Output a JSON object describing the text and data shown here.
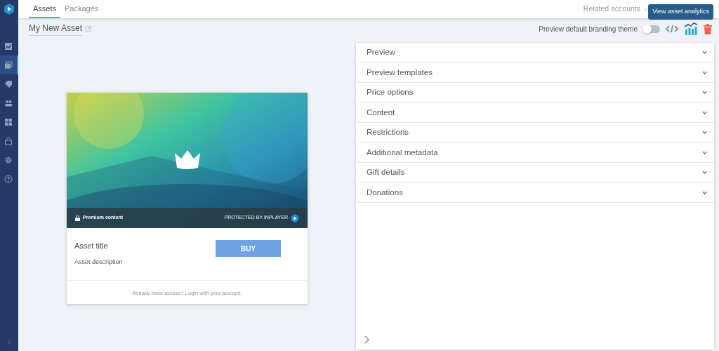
{
  "sidebar": {
    "items": [
      {
        "kind": "chart",
        "selected": false
      },
      {
        "kind": "media",
        "selected": true
      },
      {
        "kind": "tag",
        "selected": false
      },
      {
        "kind": "people",
        "selected": false
      },
      {
        "kind": "grid",
        "selected": false
      },
      {
        "kind": "lock",
        "selected": false
      },
      {
        "kind": "gear",
        "selected": false
      },
      {
        "kind": "help",
        "selected": false
      }
    ]
  },
  "tabs": [
    {
      "label": "Assets",
      "selected": true
    },
    {
      "label": "Packages",
      "selected": false
    }
  ],
  "related_accounts": "Related accounts",
  "asset_name": "My New Asset",
  "toolbar": {
    "preview_label": "Preview default branding theme",
    "preview_on": false,
    "tooltip": "View asset analytics"
  },
  "preview_card": {
    "premium_label": "Premium content",
    "protected_label": "PROTECTED BY INPLAYER",
    "title": "Asset title",
    "description": "Asset description",
    "buy": "BUY",
    "login_text": "Already have access? Login with your account."
  },
  "sections": [
    {
      "label": "Preview",
      "expanded": false
    },
    {
      "label": "Preview templates",
      "expanded": false
    },
    {
      "label": "Price options",
      "expanded": false
    },
    {
      "label": "Content",
      "expanded": false
    },
    {
      "label": "Restrictions",
      "expanded": false
    },
    {
      "label": "Additional metadata",
      "expanded": false
    },
    {
      "label": "Gift details",
      "expanded": false
    },
    {
      "label": "Donations",
      "expanded": false
    }
  ]
}
